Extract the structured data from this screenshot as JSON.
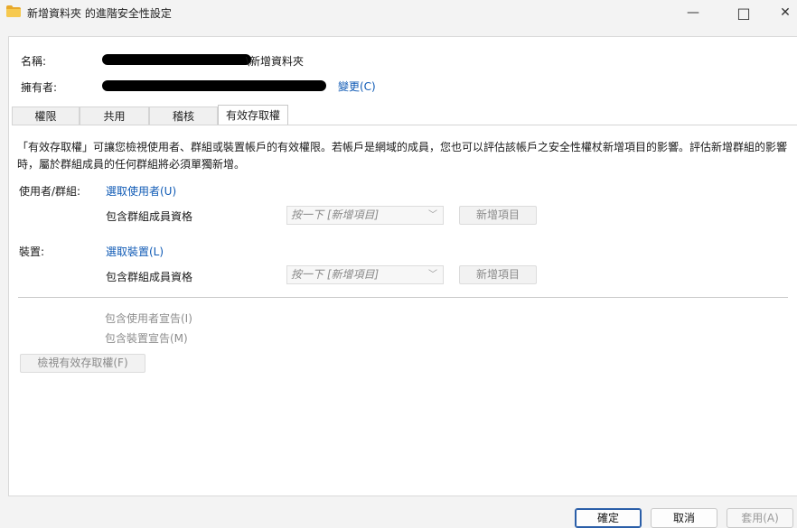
{
  "window": {
    "title": "新增資料夾 的進階安全性設定",
    "minimize_glyph": "—",
    "maximize_glyph": "□",
    "close_glyph": "✕"
  },
  "info": {
    "name_label": "名稱:",
    "name_value_suffix": "\\新增資料夾",
    "owner_label": "擁有者:",
    "change_link": "變更(C)"
  },
  "tabs": [
    {
      "label": "權限"
    },
    {
      "label": "共用"
    },
    {
      "label": "稽核"
    },
    {
      "label": "有效存取權"
    }
  ],
  "description": "「有效存取權」可讓您檢視使用者、群組或裝置帳戶的有效權限。若帳戶是網域的成員，您也可以評估該帳戶之安全性權杖新增項目的影響。評估新增群組的影響時，屬於群組成員的任何群組將必須單獨新增。",
  "user_section": {
    "label": "使用者/群組:",
    "select_link": "選取使用者(U)",
    "include_label": "包含群組成員資格",
    "combo_value": "按一下 [新增項目]",
    "add_button": "新增項目"
  },
  "device_section": {
    "label": "裝置:",
    "select_link": "選取裝置(L)",
    "include_label": "包含群組成員資格",
    "combo_value": "按一下 [新增項目]",
    "add_button": "新增項目"
  },
  "claims": {
    "user_claims": "包含使用者宣告(I)",
    "device_claims": "包含裝置宣告(M)"
  },
  "view_button": "檢視有效存取權(F)",
  "footer": {
    "ok": "確定",
    "cancel": "取消",
    "apply": "套用(A)"
  },
  "colors": {
    "link": "#0f5ab5",
    "folder": "#f2c04a",
    "default_button_border": "#2a5ea8"
  }
}
